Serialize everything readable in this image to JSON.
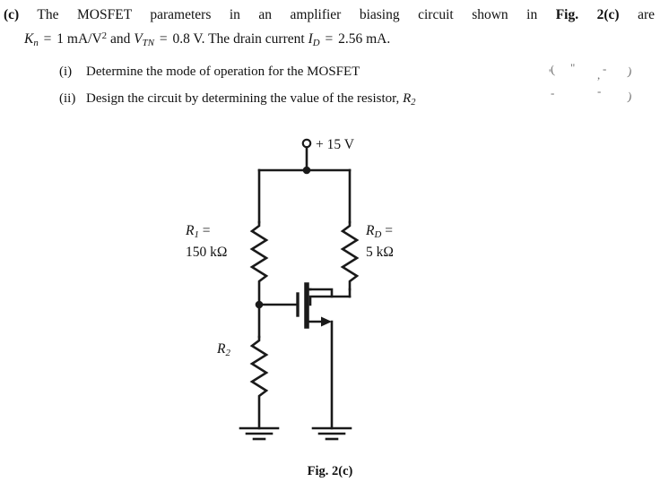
{
  "question": {
    "label": "(c)",
    "line1_parts": {
      "before_fig": "The MOSFET parameters in an amplifier biasing circuit shown in",
      "fig_ref": "Fig. 2(c)",
      "after_fig": "are"
    },
    "line2": {
      "kn_symbol": "K",
      "kn_subscript": "n",
      "kn_value": "1 mA/V",
      "kn_exponent": "2",
      "conjunction": "and",
      "vtn_symbol": "V",
      "vtn_subscript": "TN",
      "vtn_value": "0.8 V.",
      "sentence": "The drain current",
      "id_symbol": "I",
      "id_subscript": "D",
      "id_value": "2.56 mA.",
      "equals": "="
    },
    "subitems": [
      {
        "marker": "(i)",
        "text": "Determine the mode of operation for the MOSFET"
      },
      {
        "marker": "(ii)",
        "text_before": "Design the circuit by determining the value of the resistor,",
        "symbol": "R",
        "subscript": "2"
      }
    ]
  },
  "artifacts": {
    "glyphs": [
      "(",
      "\"",
      "-",
      "'",
      ",",
      ")",
      "-",
      "-",
      ")"
    ]
  },
  "circuit": {
    "supply_label": "+ 15 V",
    "r1": {
      "symbol": "R",
      "subscript": "1",
      "equals": "=",
      "value": "150 kΩ"
    },
    "rd": {
      "symbol": "R",
      "subscript": "D",
      "equals": "=",
      "value": "5 kΩ"
    },
    "r2": {
      "symbol": "R",
      "subscript": "2"
    },
    "transistor": "nmos-enhancement-mosfet",
    "ground_count": 2,
    "wire_color": "#1a1a1a"
  },
  "figure": {
    "caption": "Fig. 2(c)"
  }
}
